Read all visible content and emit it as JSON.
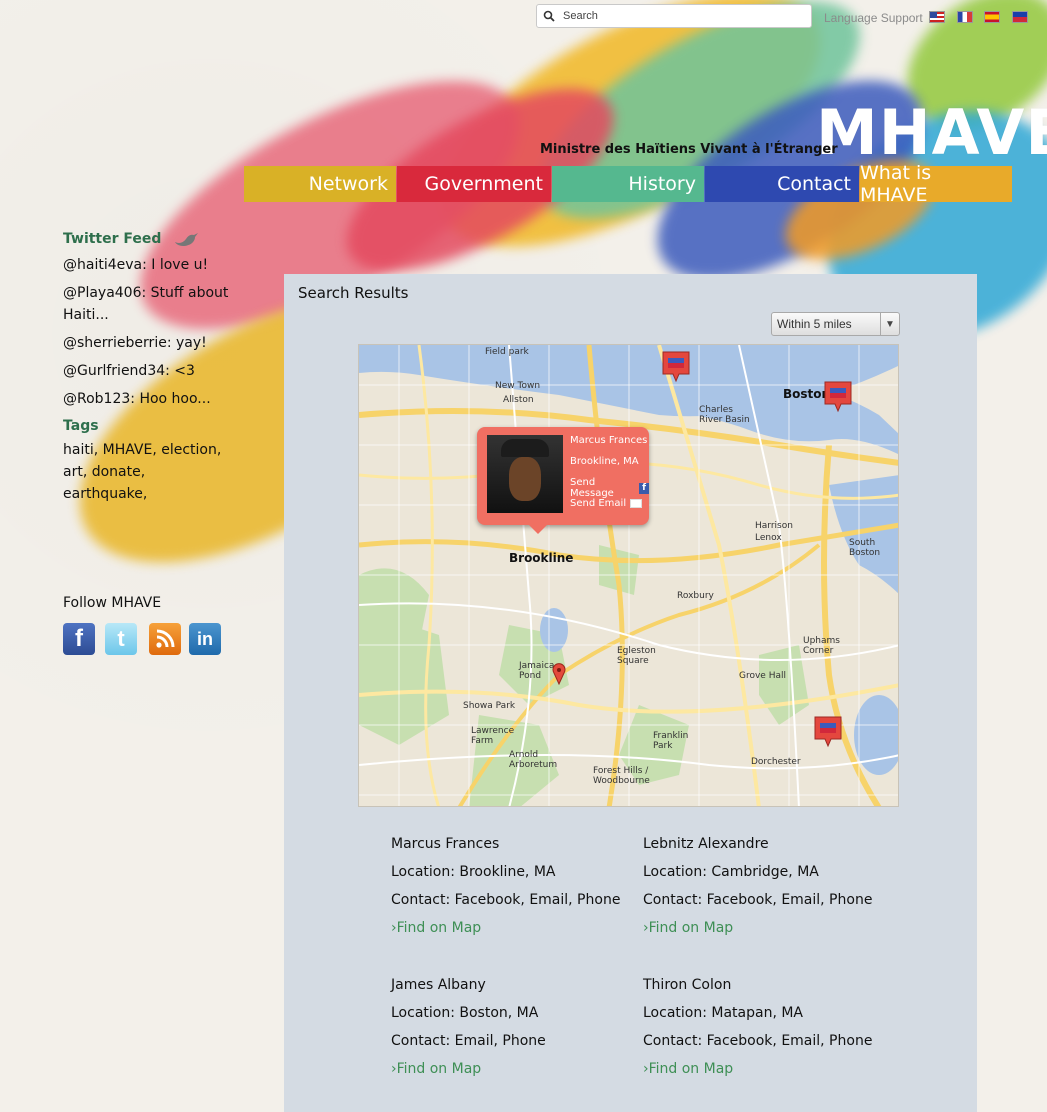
{
  "header": {
    "search_placeholder": "Search",
    "language_label": "Language Support",
    "logo": "MHAVE",
    "tagline": "Ministre des Haïtiens Vivant à l'Étranger"
  },
  "nav": {
    "network": "Network",
    "government": "Government",
    "history": "History",
    "contact": "Contact",
    "what": "What is MHAVE"
  },
  "sidebar": {
    "twitter_heading": "Twitter Feed",
    "tweets": [
      "@haiti4eva: I love u!",
      "@Playa406: Stuff about Haiti...",
      "@sherrieberrie: yay!",
      "@Gurlfriend34: <3",
      "@Rob123: Hoo hoo..."
    ],
    "tags_heading": "Tags",
    "tags_text": "haiti, MHAVE, election, art, donate, earthquake,",
    "follow_heading": "Follow MHAVE"
  },
  "panel": {
    "title": "Search Results",
    "radius_value": "Within 5 miles"
  },
  "map": {
    "labels": {
      "boston": "Boston",
      "brookline": "Brookline",
      "allston": "Allston",
      "roxbury": "Roxbury",
      "new_town": "New Town",
      "field_park": "Field park",
      "charles_river": "Charles River Basin",
      "jamaica_plain": "Jamaica Pond",
      "egleston": "Egleston Square",
      "grove_hall": "Grove Hall",
      "dorchester": "Dorchester",
      "uphams": "Uphams Corner",
      "south_boston": "South Boston",
      "harrison": "Harrison Lenox",
      "franklin": "Franklin Park",
      "showa": "Showa Park",
      "lawrence": "Lawrence Farm",
      "arnold": "Arnold Arboretum",
      "forest_hills": "Forest Hills / Woodbourne"
    },
    "popup": {
      "name": "Marcus Frances",
      "location": "Brookline, MA",
      "message": "Send Message",
      "email": "Send Email"
    }
  },
  "results": [
    {
      "name": "Marcus Frances",
      "location": "Location: Brookline, MA",
      "contact": "Contact: Facebook, Email, Phone",
      "find": "›Find on Map"
    },
    {
      "name": "Lebnitz Alexandre",
      "location": "Location: Cambridge, MA",
      "contact": "Contact: Facebook, Email, Phone",
      "find": "›Find on Map"
    },
    {
      "name": "James Albany",
      "location": "Location: Boston, MA",
      "contact": "Contact: Email, Phone",
      "find": "›Find on Map"
    },
    {
      "name": "Thiron Colon",
      "location": "Location: Matapan, MA",
      "contact": "Contact: Facebook, Email, Phone",
      "find": "›Find on Map"
    }
  ],
  "colors": {
    "network": "#d9b126",
    "government": "#d9293c",
    "history": "#55b88f",
    "contact": "#2e49b0",
    "what": "#e8aa2a",
    "panel": "#d4dbe3",
    "link_green": "#3e8f55"
  }
}
